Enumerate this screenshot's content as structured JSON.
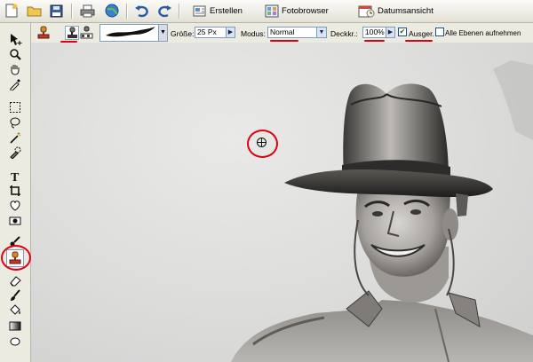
{
  "toolbar": {
    "create_label": "Erstellen",
    "photo_browser_label": "Fotobrowser",
    "date_view_label": "Datumsansicht"
  },
  "options": {
    "size_label": "Größe:",
    "size_value": "25 Px",
    "mode_label": "Modus:",
    "mode_value": "Normal",
    "opacity_label": "Deckkr.:",
    "opacity_value": "100%",
    "aligned_label": "Ausger.",
    "aligned_checked": true,
    "all_layers_label": "Alle Ebenen aufnehmen",
    "all_layers_checked": false
  },
  "colors": {
    "highlight": "#e00010",
    "toolbar_bg": "#ecebe2"
  }
}
